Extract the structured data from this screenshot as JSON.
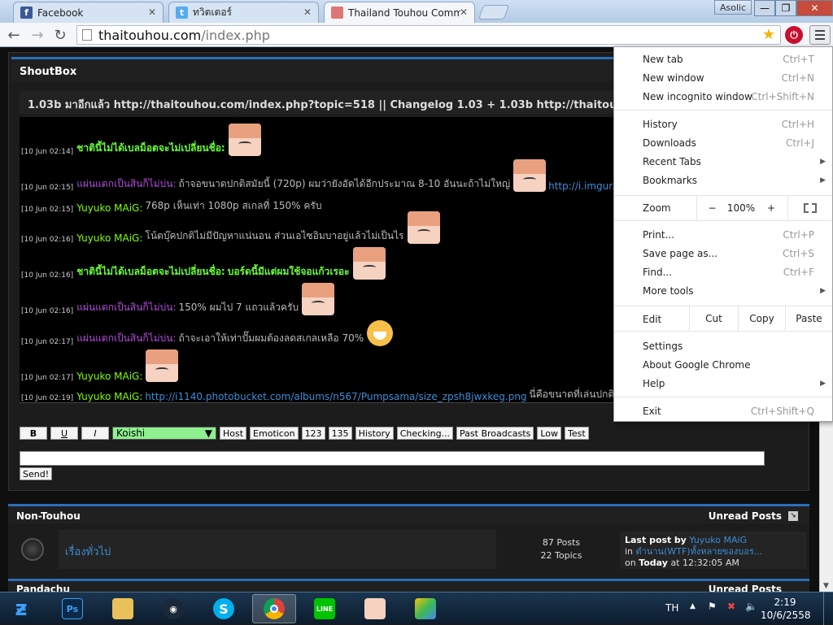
{
  "browser": {
    "tabs": [
      {
        "title": "Facebook",
        "icon": "facebook-icon"
      },
      {
        "title": "ทวิตเตอร์",
        "icon": "twitter-icon"
      },
      {
        "title": "Thailand Touhou Commu",
        "icon": "page-icon",
        "active": true
      }
    ],
    "user": "Asolic",
    "url_host": "thaitouhou.com",
    "url_path": "/index.php"
  },
  "shoutbox": {
    "title": "ShoutBox",
    "marquee": "1.03b มาอีกแล้ว http://thaitouhou.com/index.php?topic=518 || Changelog 1.03 + 1.03b http://thaitouhou.com/inde",
    "messages": [
      {
        "ts": "[10 Jun 02:14]",
        "name": "ชาตินี้ไม่ได้เบลม็อตจะไม่เปลี่ยนชื่อ:",
        "name_style": "g",
        "text": "",
        "link": "",
        "sticker": "avatar"
      },
      {
        "ts": "[10 Jun 02:15]",
        "name": "แผ่นแตกเป็นสินก็ไม่บ่น:",
        "name_style": "p",
        "text": "ถ้าจอขนาดปกติสมัยนี้ (720p) ผมว่ายังอัดได้อีกประมาณ 8-10 อันนะถ้าไม่ใหญ่",
        "link": "http://i.imgur.c",
        "sticker": "avatar"
      },
      {
        "ts": "[10 Jun 02:15]",
        "name": "Yuyuko MAiG:",
        "name_style": "y",
        "text": "768p เห็นเท่า 1080p สเกลที่ 150% ครับ",
        "link": "",
        "sticker": ""
      },
      {
        "ts": "[10 Jun 02:16]",
        "name": "Yuyuko MAiG:",
        "name_style": "y",
        "text": "โน้ตบุ๊คปกติไม่มีปัญหาแน่นอน ส่วนเอไซอิมบาอยู่แล้วไม่เป็นไร",
        "link": "",
        "sticker": "avatar"
      },
      {
        "ts": "[10 Jun 02:16]",
        "name": "ชาตินี้ไม่ได้เบลม็อตจะไม่เปลี่ยนชื่อ:",
        "name_style": "g",
        "text": "บอร์ดนี้มีแต่ผมใช้จอแก้วเรอะ",
        "link": "",
        "sticker": "avatar"
      },
      {
        "ts": "[10 Jun 02:16]",
        "name": "แผ่นแตกเป็นสินก็ไม่บ่น:",
        "name_style": "p",
        "text": "150% ผมไป 7 แถวแล้วครับ",
        "link": "",
        "sticker": "avatar"
      },
      {
        "ts": "[10 Jun 02:17]",
        "name": "แผ่นแตกเป็นสินก็ไม่บ่น:",
        "name_style": "p",
        "text": "ถ้าจะเอาให้เท่าปั๊มผมต้องลดสเกลเหลือ 70%",
        "link": "",
        "sticker": "smiley"
      },
      {
        "ts": "[10 Jun 02:17]",
        "name": "Yuyuko MAiG:",
        "name_style": "y",
        "text": "",
        "link": "",
        "sticker": "avatar"
      },
      {
        "ts": "[10 Jun 02:19]",
        "name": "Yuyuko MAiG:",
        "name_style": "y",
        "text": "",
        "link": "http://i1140.photobucket.com/albums/n567/Pumpsama/size_zpsh8jwxkeg.png",
        "after": "นี่คือขนาดที่เล่นปกติ",
        "sticker": ""
      }
    ],
    "toolbar": {
      "bold": "B",
      "underline": "U",
      "italic": "I",
      "font_select": "Koishi",
      "buttons": [
        "Host",
        "Emoticon",
        "123",
        "135",
        "History",
        "Checking...",
        "Past Broadcasts",
        "Low",
        "Test"
      ]
    },
    "input_value": "",
    "send_label": "Send!"
  },
  "category": {
    "title": "Non-Touhou",
    "unread_label": "Unread Posts",
    "board": {
      "name": "เรื่องทั่วไป",
      "posts": "87 Posts",
      "topics": "22 Topics",
      "last_post_label": "Last post",
      "by_word": "by",
      "last_post_user": "Yuyuko MAiG",
      "in_word": "in",
      "last_post_topic": "ตำนาน(WTF)ทั้งหลายของบอร...",
      "on_word": "on",
      "last_post_day": "Today",
      "at_word": "at",
      "last_post_time": "12:32:05 AM"
    },
    "next_title": "Pandachu",
    "next_right": "Unread Posts"
  },
  "chrome_menu": {
    "items_top": [
      {
        "label": "New tab",
        "shortcut": "Ctrl+T"
      },
      {
        "label": "New window",
        "shortcut": "Ctrl+N"
      },
      {
        "label": "New incognito window",
        "shortcut": "Ctrl+Shift+N"
      }
    ],
    "items_mid": [
      {
        "label": "History",
        "shortcut": "Ctrl+H"
      },
      {
        "label": "Downloads",
        "shortcut": "Ctrl+J"
      },
      {
        "label": "Recent Tabs",
        "shortcut": "",
        "submenu": true
      },
      {
        "label": "Bookmarks",
        "shortcut": "",
        "submenu": true
      }
    ],
    "zoom": {
      "label": "Zoom",
      "minus": "−",
      "value": "100%",
      "plus": "+"
    },
    "items_print": [
      {
        "label": "Print...",
        "shortcut": "Ctrl+P"
      },
      {
        "label": "Save page as...",
        "shortcut": "Ctrl+S"
      },
      {
        "label": "Find...",
        "shortcut": "Ctrl+F"
      },
      {
        "label": "More tools",
        "shortcut": "",
        "submenu": true
      }
    ],
    "edit": {
      "label": "Edit",
      "cut": "Cut",
      "copy": "Copy",
      "paste": "Paste"
    },
    "items_bottom": [
      {
        "label": "Settings",
        "shortcut": ""
      },
      {
        "label": "About Google Chrome",
        "shortcut": ""
      },
      {
        "label": "Help",
        "shortcut": "",
        "submenu": true
      }
    ],
    "exit": {
      "label": "Exit",
      "shortcut": "Ctrl+Shift+Q"
    }
  },
  "taskbar": {
    "apps": [
      "photoshop",
      "file-explorer",
      "steam",
      "skype",
      "chrome",
      "line",
      "anime-app",
      "bluestacks"
    ],
    "line_label": "LINE",
    "ps_label": "Ps",
    "lang": "TH",
    "time": "2:19",
    "date": "10/6/2558"
  }
}
